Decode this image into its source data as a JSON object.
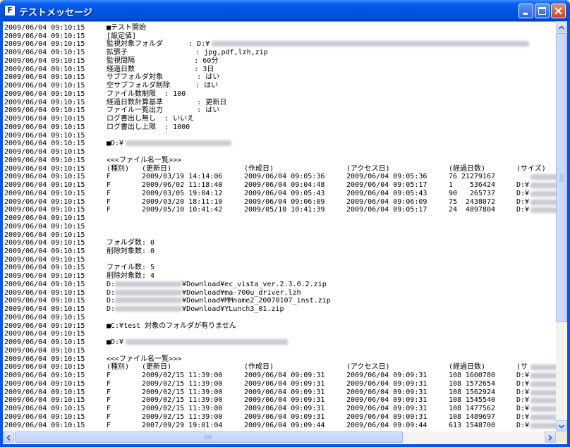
{
  "window": {
    "title": "テストメッセージ",
    "icon": "app-icon",
    "icon_letter": "F"
  },
  "log_lines": [
    {
      "ts": "2009/06/04 09:10:15",
      "msg": "■テスト開始"
    },
    {
      "ts": "2009/06/04 09:10:15",
      "msg": "[設定値]"
    },
    {
      "ts": "2009/06/04 09:10:15",
      "msg": "監視対象フォルダ      : D:¥",
      "redacted": true
    },
    {
      "ts": "2009/06/04 09:10:15",
      "msg": "拡張子                : jpg,pdf,lzh,zip"
    },
    {
      "ts": "2009/06/04 09:10:15",
      "msg": "監視間隔              : 60分"
    },
    {
      "ts": "2009/06/04 09:10:15",
      "msg": "経過日数              : 3日"
    },
    {
      "ts": "2009/06/04 09:10:15",
      "msg": "サブフォルダ対象        : はい"
    },
    {
      "ts": "2009/06/04 09:10:15",
      "msg": "空サブフォルダ削除      : はい"
    },
    {
      "ts": "2009/06/04 09:10:15",
      "msg": "ファイル数制限  : 100"
    },
    {
      "ts": "2009/06/04 09:10:15",
      "msg": "経過日数計算基準        : 更新日"
    },
    {
      "ts": "2009/06/04 09:10:15",
      "msg": "ファイル一覧出力        : はい"
    },
    {
      "ts": "2009/06/04 09:10:15",
      "msg": "ログ書出し無し  : いいえ"
    },
    {
      "ts": "2009/06/04 09:10:15",
      "msg": "ログ書出し上限  : 1000"
    },
    {
      "ts": "2009/06/04 09:10:15",
      "msg": ""
    },
    {
      "ts": "2009/06/04 09:10:15",
      "msg": "■D:¥",
      "redacted": true
    },
    {
      "ts": "2009/06/04 09:10:15",
      "msg": ""
    },
    {
      "ts": "2009/06/04 09:10:15",
      "msg": "<<<ファイル名一覧>>>"
    },
    {
      "ts": "2009/06/04 09:10:15",
      "cols": [
        "(種別)",
        "(更新日)",
        "(作成日)",
        "(アクセス日)",
        "(経過日数)",
        "",
        "(サイズ)"
      ]
    },
    {
      "ts": "2009/06/04 09:10:15",
      "cols": [
        "F",
        "2009/03/19 14:14:06",
        "2009/06/04 09:05:36",
        "2009/06/04 09:05:36",
        "76",
        "21279167",
        ""
      ],
      "redacted": true
    },
    {
      "ts": "2009/06/04 09:10:15",
      "cols": [
        "F",
        "2009/06/02 11:18:40",
        "2009/06/04 09:04:48",
        "2009/06/04 09:05:17",
        "1",
        "536424",
        "D:¥"
      ],
      "redacted": true
    },
    {
      "ts": "2009/06/04 09:10:15",
      "cols": [
        "F",
        "2009/03/05 19:04:12",
        "2009/06/04 09:05:43",
        "2009/06/04 09:05:43",
        "90",
        "265737",
        "D:¥"
      ],
      "redacted": true
    },
    {
      "ts": "2009/06/04 09:10:15",
      "cols": [
        "F",
        "2009/03/20 18:11:10",
        "2009/06/04 09:06:09",
        "2009/06/04 09:06:09",
        "75",
        "2438072",
        "D:¥"
      ],
      "redacted": true
    },
    {
      "ts": "2009/06/04 09:10:15",
      "cols": [
        "F",
        "2009/05/10 10:41:42",
        "2009/05/10 10:41:39",
        "2009/06/04 09:05:17",
        "24",
        "4897804",
        "D:¥"
      ],
      "redacted": true
    },
    {
      "ts": "2009/06/04 09:10:15",
      "msg": ""
    },
    {
      "ts": "2009/06/04 09:10:15",
      "msg": ""
    },
    {
      "ts": "2009/06/04 09:10:15",
      "msg": ""
    },
    {
      "ts": "2009/06/04 09:10:15",
      "msg": "フォルダ数: 0"
    },
    {
      "ts": "2009/06/04 09:10:15",
      "msg": "削除対象数: 0"
    },
    {
      "ts": "2009/06/04 09:10:15",
      "msg": ""
    },
    {
      "ts": "2009/06/04 09:10:15",
      "msg": "ファイル数: 5"
    },
    {
      "ts": "2009/06/04 09:10:15",
      "msg": "削除対象数: 4"
    },
    {
      "ts": "2009/06/04 09:10:15",
      "msg": "D:",
      "redacted_mid": true,
      "msg_tail": "¥Download¥ec_vista_ver.2.3.0.2.zip"
    },
    {
      "ts": "2009/06/04 09:10:15",
      "msg": "D:",
      "redacted_mid": true,
      "msg_tail": "¥Download¥ma-700u_driver.lzh"
    },
    {
      "ts": "2009/06/04 09:10:15",
      "msg": "D:",
      "redacted_mid": true,
      "msg_tail": "¥Download¥MMname2_20070107_inst.zip"
    },
    {
      "ts": "2009/06/04 09:10:15",
      "msg": "D:",
      "redacted_mid": true,
      "msg_tail": "¥Download¥YLunch3_01.zip"
    },
    {
      "ts": "2009/06/04 09:10:15",
      "msg": ""
    },
    {
      "ts": "2009/06/04 09:10:15",
      "msg": "■C:¥test 対象のフォルダが有りません"
    },
    {
      "ts": "2009/06/04 09:10:15",
      "msg": ""
    },
    {
      "ts": "2009/06/04 09:10:15",
      "msg": "■D:¥",
      "redacted": true
    },
    {
      "ts": "2009/06/04 09:10:15",
      "msg": ""
    },
    {
      "ts": "2009/06/04 09:10:15",
      "msg": "<<<ファイル名一覧>>>"
    },
    {
      "ts": "2009/06/04 09:10:15",
      "cols": [
        "(種別)",
        "(更新日)",
        "(作成日)",
        "(アクセス日)",
        "(経過日数)",
        "",
        "(サ"
      ],
      "redacted": true
    },
    {
      "ts": "2009/06/04 09:10:15",
      "cols": [
        "F",
        "2009/02/15 11:39:00",
        "2009/06/04 09:09:31",
        "2009/06/04 09:09:31",
        "108",
        "1600780",
        "D:¥"
      ],
      "redacted": true
    },
    {
      "ts": "2009/06/04 09:10:15",
      "cols": [
        "F",
        "2009/02/15 11:39:00",
        "2009/06/04 09:09:31",
        "2009/06/04 09:09:31",
        "108",
        "1572654",
        "D:¥"
      ],
      "redacted": true
    },
    {
      "ts": "2009/06/04 09:10:15",
      "cols": [
        "F",
        "2009/02/15 11:39:00",
        "2009/06/04 09:09:31",
        "2009/06/04 09:09:31",
        "108",
        "1562924",
        "D:¥"
      ],
      "redacted": true
    },
    {
      "ts": "2009/06/04 09:10:15",
      "cols": [
        "F",
        "2009/02/15 11:39:00",
        "2009/06/04 09:09:31",
        "2009/06/04 09:09:31",
        "108",
        "1545540",
        "D:¥"
      ],
      "redacted": true
    },
    {
      "ts": "2009/06/04 09:10:15",
      "cols": [
        "F",
        "2009/02/15 11:39:00",
        "2009/06/04 09:09:31",
        "2009/06/04 09:09:31",
        "108",
        "1477562",
        "D:¥"
      ],
      "redacted": true
    },
    {
      "ts": "2009/06/04 09:10:15",
      "cols": [
        "F",
        "2009/02/15 11:39:00",
        "2009/06/04 09:09:31",
        "2009/06/04 09:09:31",
        "108",
        "1489697",
        "D:¥"
      ],
      "redacted": true
    },
    {
      "ts": "2009/06/04 09:10:15",
      "cols": [
        "F",
        "2007/09/29 19:01:04",
        "2009/06/04 09:09:44",
        "2009/06/04 09:09:44",
        "613",
        "1548700",
        "D:¥"
      ],
      "redacted": true
    }
  ],
  "scrollbar": {
    "vertical_position": 0.0,
    "horizontal_position": 0.0
  }
}
